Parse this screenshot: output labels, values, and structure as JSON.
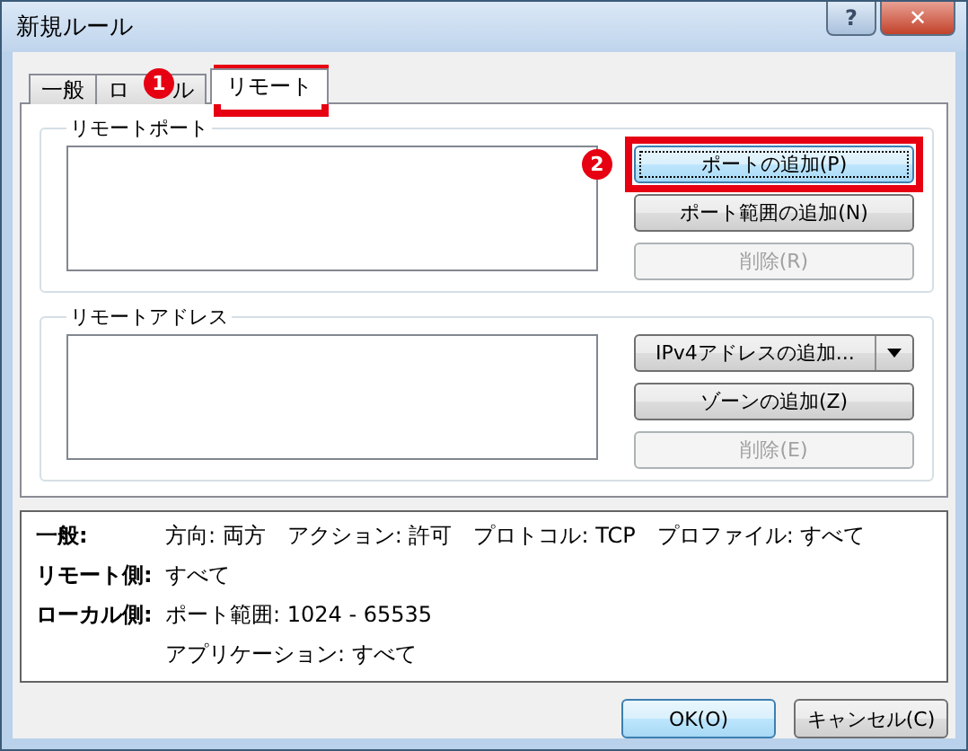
{
  "window": {
    "title": "新規ルール",
    "help_button": "?",
    "close_button": "✕"
  },
  "tabs": [
    {
      "label": "一般",
      "selected": false
    },
    {
      "label_parts": [
        "ロ",
        "ル"
      ],
      "selected": false
    },
    {
      "label": "リモート",
      "selected": true
    }
  ],
  "groups": [
    {
      "title": "リモートポート",
      "buttons": [
        {
          "label": "ポートの追加(P)",
          "disabled": false,
          "focused": true,
          "kind": "plain"
        },
        {
          "label": "ポート範囲の追加(N)",
          "disabled": false,
          "focused": false,
          "kind": "plain"
        },
        {
          "label": "削除(R)",
          "disabled": true,
          "focused": false,
          "kind": "plain"
        }
      ]
    },
    {
      "title": "リモートアドレス",
      "buttons": [
        {
          "label": "IPv4アドレスの追加...",
          "kind": "split"
        },
        {
          "label": "ゾーンの追加(Z)",
          "disabled": false,
          "focused": false,
          "kind": "plain"
        },
        {
          "label": "削除(E)",
          "disabled": true,
          "focused": false,
          "kind": "plain"
        }
      ]
    }
  ],
  "summary": [
    {
      "label": "一般:",
      "values": [
        "方向: 両方",
        "アクション: 許可",
        "プロトコル: TCP",
        "プロファイル: すべて"
      ]
    },
    {
      "label": "リモート側:",
      "values": [
        "すべて"
      ]
    },
    {
      "label": "ローカル側:",
      "values": [
        "ポート範囲: 1024 - 65535"
      ]
    },
    {
      "values": [
        "アプリケーション: すべて"
      ]
    }
  ],
  "footer_buttons": [
    {
      "label": "OK(O)",
      "default": true
    },
    {
      "label": "キャンセル(C)",
      "default": false
    }
  ],
  "annotations": [
    {
      "number": "1"
    },
    {
      "number": "2"
    }
  ]
}
